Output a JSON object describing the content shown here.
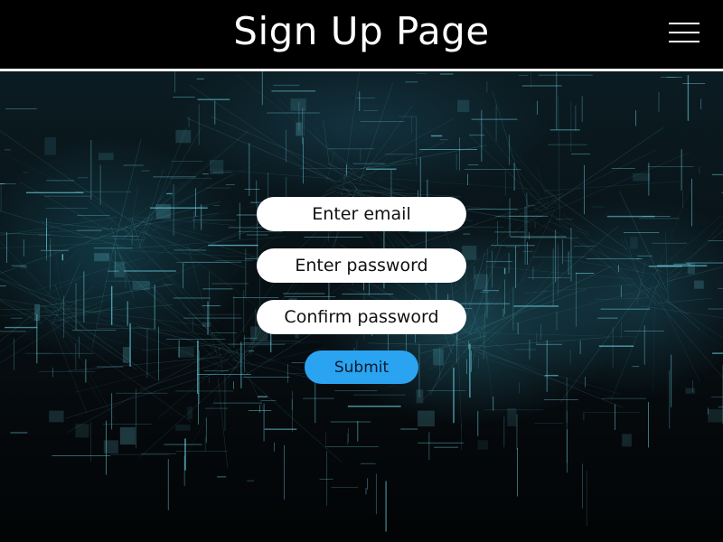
{
  "header": {
    "title": "Sign Up Page",
    "menu_icon": "hamburger-menu-icon"
  },
  "form": {
    "email_placeholder": "Enter email",
    "password_placeholder": "Enter password",
    "confirm_placeholder": "Confirm password",
    "submit_label": "Submit"
  },
  "colors": {
    "header_bg": "#000000",
    "submit_bg": "#2aa4f1",
    "field_bg": "#ffffff",
    "accent_line": "#6fd8e8"
  }
}
